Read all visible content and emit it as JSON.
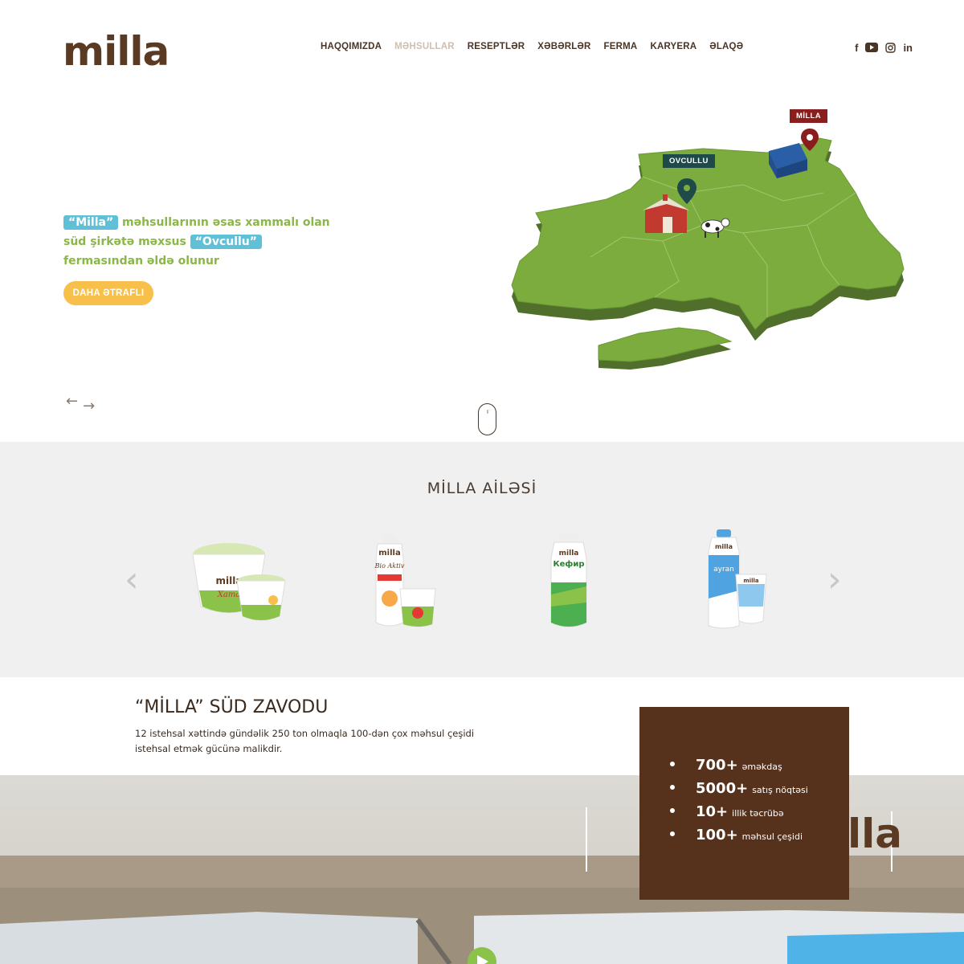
{
  "brand": {
    "logo_text": "milla",
    "primary_color": "#56311b",
    "accent_green": "#8bb64a",
    "accent_blue": "#5fc0d8",
    "accent_yellow": "#f7c04a"
  },
  "nav": {
    "items": [
      "HAQQIMIZDA",
      "MƏHSULLAR",
      "RESEPTLƏR",
      "XƏBƏRLƏR",
      "FERMA",
      "KARYERA",
      "ƏLAQƏ"
    ],
    "active": "MƏHSULLAR"
  },
  "social": {
    "facebook": "f",
    "youtube": "▶",
    "instagram": "◎",
    "linkedin": "in"
  },
  "hero": {
    "hl1": "“Milla”",
    "text1": " məhsullarının əsas xammalı olan süd şirkətə məxsus ",
    "hl2": "“Ovcullu”",
    "text2": "  fermasından əldə olunur",
    "button": "DAHA ƏTRAFLI",
    "prev_arrow": "←",
    "next_arrow": "→",
    "map_labels": {
      "milla": "MİLLA",
      "ovcullu": "OVCULLU"
    }
  },
  "family": {
    "title": "MİLLA AİLƏSİ",
    "prev": "‹",
    "next": "›",
    "products": [
      {
        "icon": "smetana-tub-icon",
        "brand": "milla",
        "name": "Xama"
      },
      {
        "icon": "bio-aktiv-bottle-icon",
        "brand": "milla",
        "name": "Bio Aktiv"
      },
      {
        "icon": "kefir-bottle-icon",
        "brand": "milla",
        "name": "Кефир"
      },
      {
        "icon": "ayran-bottle-icon",
        "brand": "milla",
        "name": "ayran"
      }
    ]
  },
  "factory": {
    "title": "“MİLLA” SÜD ZAVODU",
    "description": "12 istehsal xəttində gündəlik 250 ton olmaqla 100-dən çox məhsul çeşidi istehsal etmək gücünə malikdir.",
    "photo_sign": "lla",
    "stats": [
      {
        "num": "700+",
        "label": "əməkdaş"
      },
      {
        "num": "5000+",
        "label": "satış nöqtəsi"
      },
      {
        "num": "10+",
        "label": "illik təcrübə"
      },
      {
        "num": "100+",
        "label": "məhsul çeşidi"
      }
    ]
  }
}
